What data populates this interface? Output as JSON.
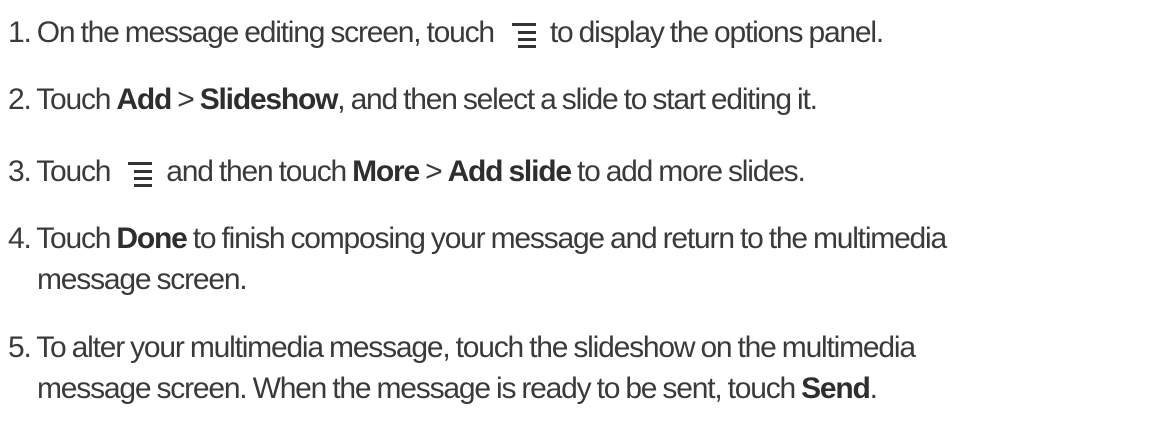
{
  "steps": [
    {
      "number": "1.",
      "parts": [
        {
          "text": "On the message editing screen, touch"
        },
        {
          "icon": "menu-icon"
        },
        {
          "text": "to display the options panel."
        }
      ]
    },
    {
      "number": "2.",
      "parts": [
        {
          "text": "Touch "
        },
        {
          "bold": "Add"
        },
        {
          "text": " > "
        },
        {
          "bold": "Slideshow"
        },
        {
          "text": ", and then select a slide to start editing it."
        }
      ]
    },
    {
      "number": "3.",
      "parts": [
        {
          "text": "Touch"
        },
        {
          "icon": "menu-icon"
        },
        {
          "text": "and then touch "
        },
        {
          "bold": "More"
        },
        {
          "text": " > "
        },
        {
          "bold": "Add slide"
        },
        {
          "text": " to add more slides."
        }
      ]
    },
    {
      "number": "4.",
      "parts": [
        {
          "text": "Touch "
        },
        {
          "bold": "Done"
        },
        {
          "text": " to finish composing your message and return to the multimedia"
        }
      ],
      "continuation": "message screen."
    },
    {
      "number": "5.",
      "parts": [
        {
          "text": "To alter your multimedia message, touch the slideshow on the multimedia"
        }
      ],
      "continuation_parts": [
        {
          "text": "message screen. When the message is ready to be sent, touch "
        },
        {
          "bold": "Send"
        },
        {
          "text": "."
        }
      ]
    }
  ]
}
